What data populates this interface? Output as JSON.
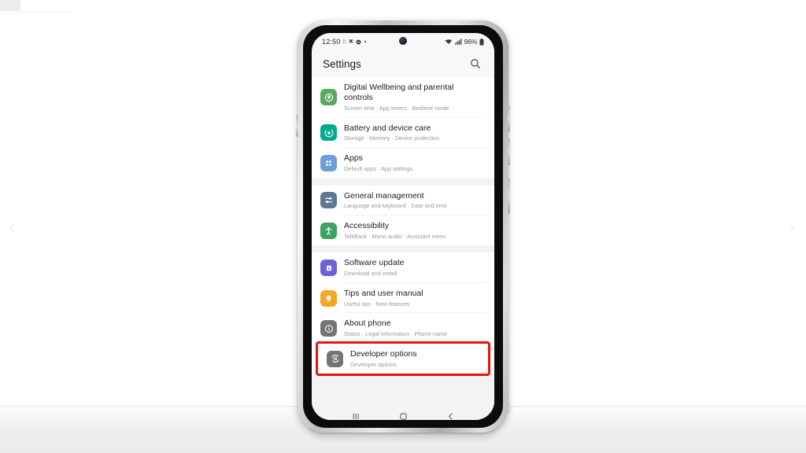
{
  "page": {
    "background_color": "#ffffff",
    "highlight_color": "#e8140f"
  },
  "carousel": {
    "prev_glyph": "‹",
    "next_glyph": "›",
    "prev_name": "previous",
    "next_name": "next"
  },
  "phone": {
    "status_bar": {
      "time": "12:50",
      "left_icons": [
        "alarm-icon",
        "mute-icon",
        "dnd-icon",
        "dot-indicator"
      ],
      "battery_percent": "96%",
      "right_icons": [
        "wifi-icon",
        "signal-icon",
        "battery-icon"
      ]
    },
    "header": {
      "title": "Settings",
      "search_icon": "search-icon"
    },
    "nav_bar": {
      "recents_label": "|||",
      "home_label": "▢",
      "back_label": "‹"
    }
  },
  "settings": {
    "groups": [
      {
        "items": [
          {
            "title": "Digital Wellbeing and parental controls",
            "subtitle": "Screen time  ·  App timers  ·  Bedtime mode",
            "icon": "wellbeing-icon",
            "icon_color": "#5aaa5e"
          },
          {
            "title": "Battery and device care",
            "subtitle": "Storage  ·  Memory  ·  Device protection",
            "icon": "battery-care-icon",
            "icon_color": "#00a98f"
          },
          {
            "title": "Apps",
            "subtitle": "Default apps  ·  App settings",
            "icon": "apps-grid-icon",
            "icon_color": "#6d9ed6"
          }
        ]
      },
      {
        "items": [
          {
            "title": "General management",
            "subtitle": "Language and keyboard  ·  Date and time",
            "icon": "sliders-icon",
            "icon_color": "#5d7893"
          },
          {
            "title": "Accessibility",
            "subtitle": "TalkBack  ·  Mono audio  ·  Assistant menu",
            "icon": "accessibility-icon",
            "icon_color": "#3aa35f"
          }
        ]
      },
      {
        "items": [
          {
            "title": "Software update",
            "subtitle": "Download and install",
            "icon": "software-update-icon",
            "icon_color": "#6a63d8"
          },
          {
            "title": "Tips and user manual",
            "subtitle": "Useful tips  ·  New features",
            "icon": "lightbulb-icon",
            "icon_color": "#f5a623"
          },
          {
            "title": "About phone",
            "subtitle": "Status  ·  Legal information  ·  Phone name",
            "icon": "info-icon",
            "icon_color": "#747474"
          },
          {
            "title": "Developer options",
            "subtitle": "Developer options",
            "icon": "developer-options-icon",
            "icon_color": "#747474",
            "highlighted": true
          }
        ]
      }
    ]
  }
}
